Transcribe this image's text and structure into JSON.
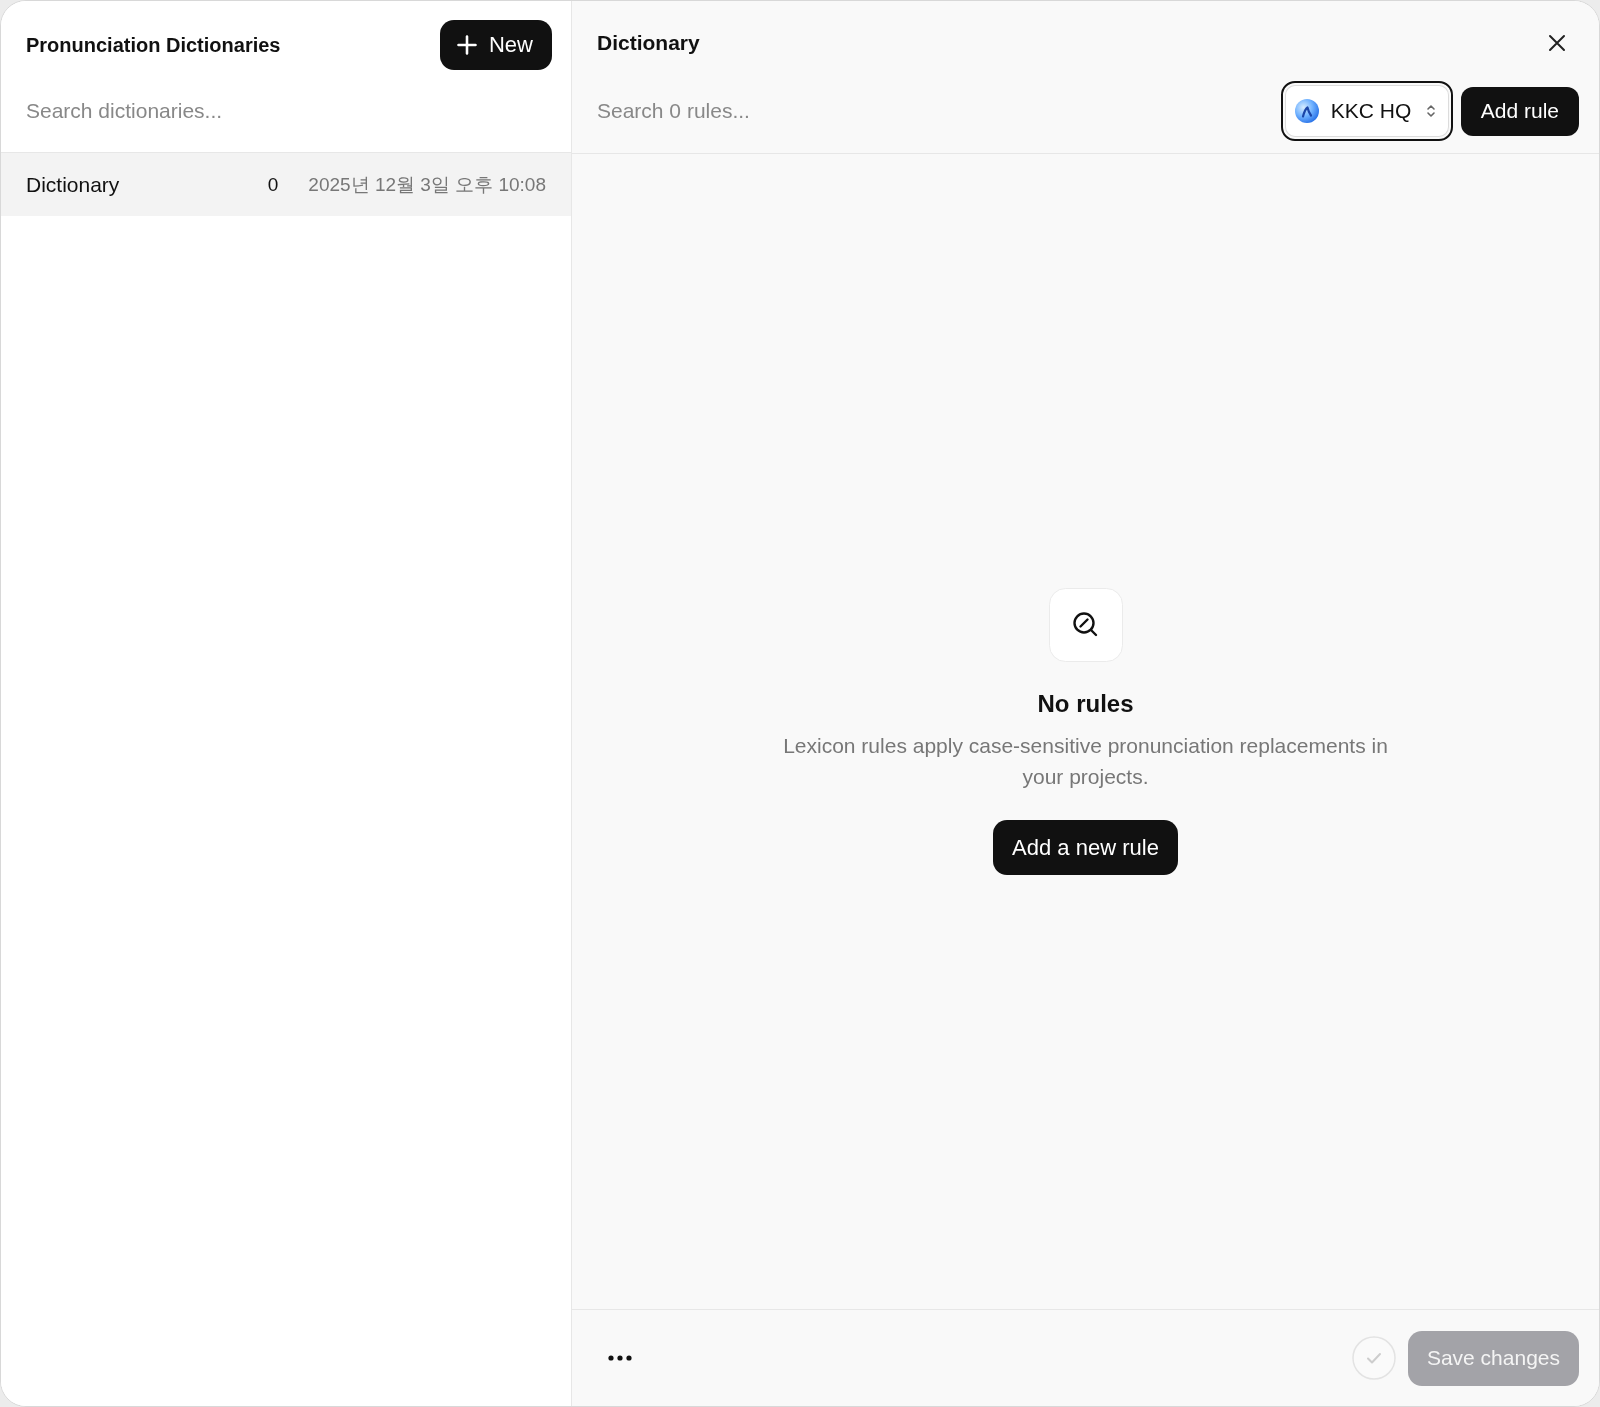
{
  "sidebar": {
    "title": "Pronunciation Dictionaries",
    "new_button": "New",
    "search": {
      "placeholder": "Search dictionaries..."
    },
    "items": [
      {
        "name": "Dictionary",
        "count": "0",
        "date": "2025년 12월 3일 오후 10:08",
        "selected": true
      }
    ]
  },
  "detail": {
    "title": "Dictionary",
    "search": {
      "placeholder": "Search 0 rules..."
    },
    "workspace_select": {
      "value": "KKC HQ",
      "focused": true
    },
    "add_button": "Add rule",
    "empty_state": {
      "title": "No rules",
      "description": "Lexicon rules apply case-sensitive pronunciation replacements in your projects.",
      "button": "Add a new rule"
    },
    "save_button": {
      "label": "Save changes",
      "disabled": true
    }
  }
}
